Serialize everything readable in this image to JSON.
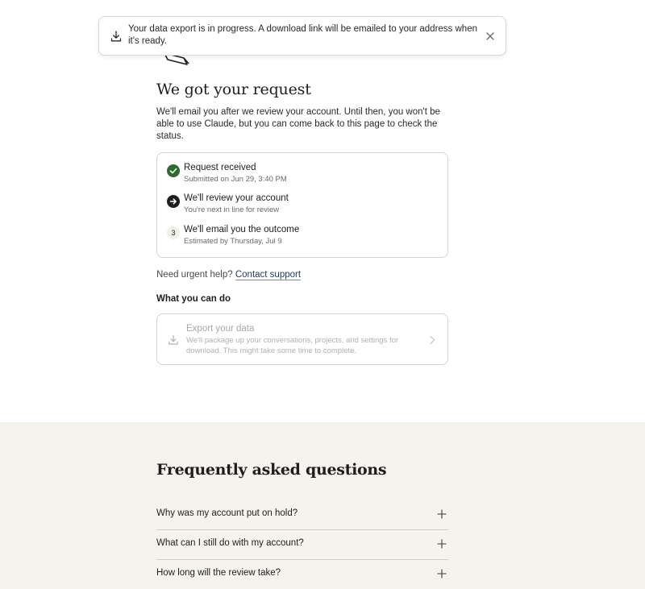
{
  "toast": {
    "message": "Your data export is in progress. A download link will be emailed to your address when it's ready.",
    "icon": "download-icon",
    "close_icon": "close-icon"
  },
  "page": {
    "title": "We got your request",
    "intro": "We'll email you after we review your account. Until then, you won't be able to use Claude, but you can come back to this page to check the status."
  },
  "steps": [
    {
      "title": "Request received",
      "subtitle": "Submitted on Jun 29, 3:40 PM",
      "state": "done"
    },
    {
      "title": "We'll review your account",
      "subtitle": "You're next in line for review",
      "state": "current"
    },
    {
      "title": "We'll email you the outcome",
      "subtitle": "Estimated by Thursday, Jul 9",
      "state": "pending",
      "number": "3"
    }
  ],
  "help": {
    "prefix": "Need urgent help?",
    "link": "Contact support"
  },
  "actions": {
    "heading": "What you can do",
    "export": {
      "title": "Export your data",
      "description": "We'll package up your conversations, projects, and settings for download. This might take some time to complete."
    }
  },
  "faq": {
    "title": "Frequently asked questions",
    "items": [
      {
        "question": "Why was my account put on hold?"
      },
      {
        "question": "What can I still do with my account?"
      },
      {
        "question": "How long will the review take?"
      }
    ]
  },
  "colors": {
    "done": "#2f6a30",
    "current": "#1f1e1c",
    "link": "#1d3a5f",
    "faq_background": "#f4f3ee"
  }
}
